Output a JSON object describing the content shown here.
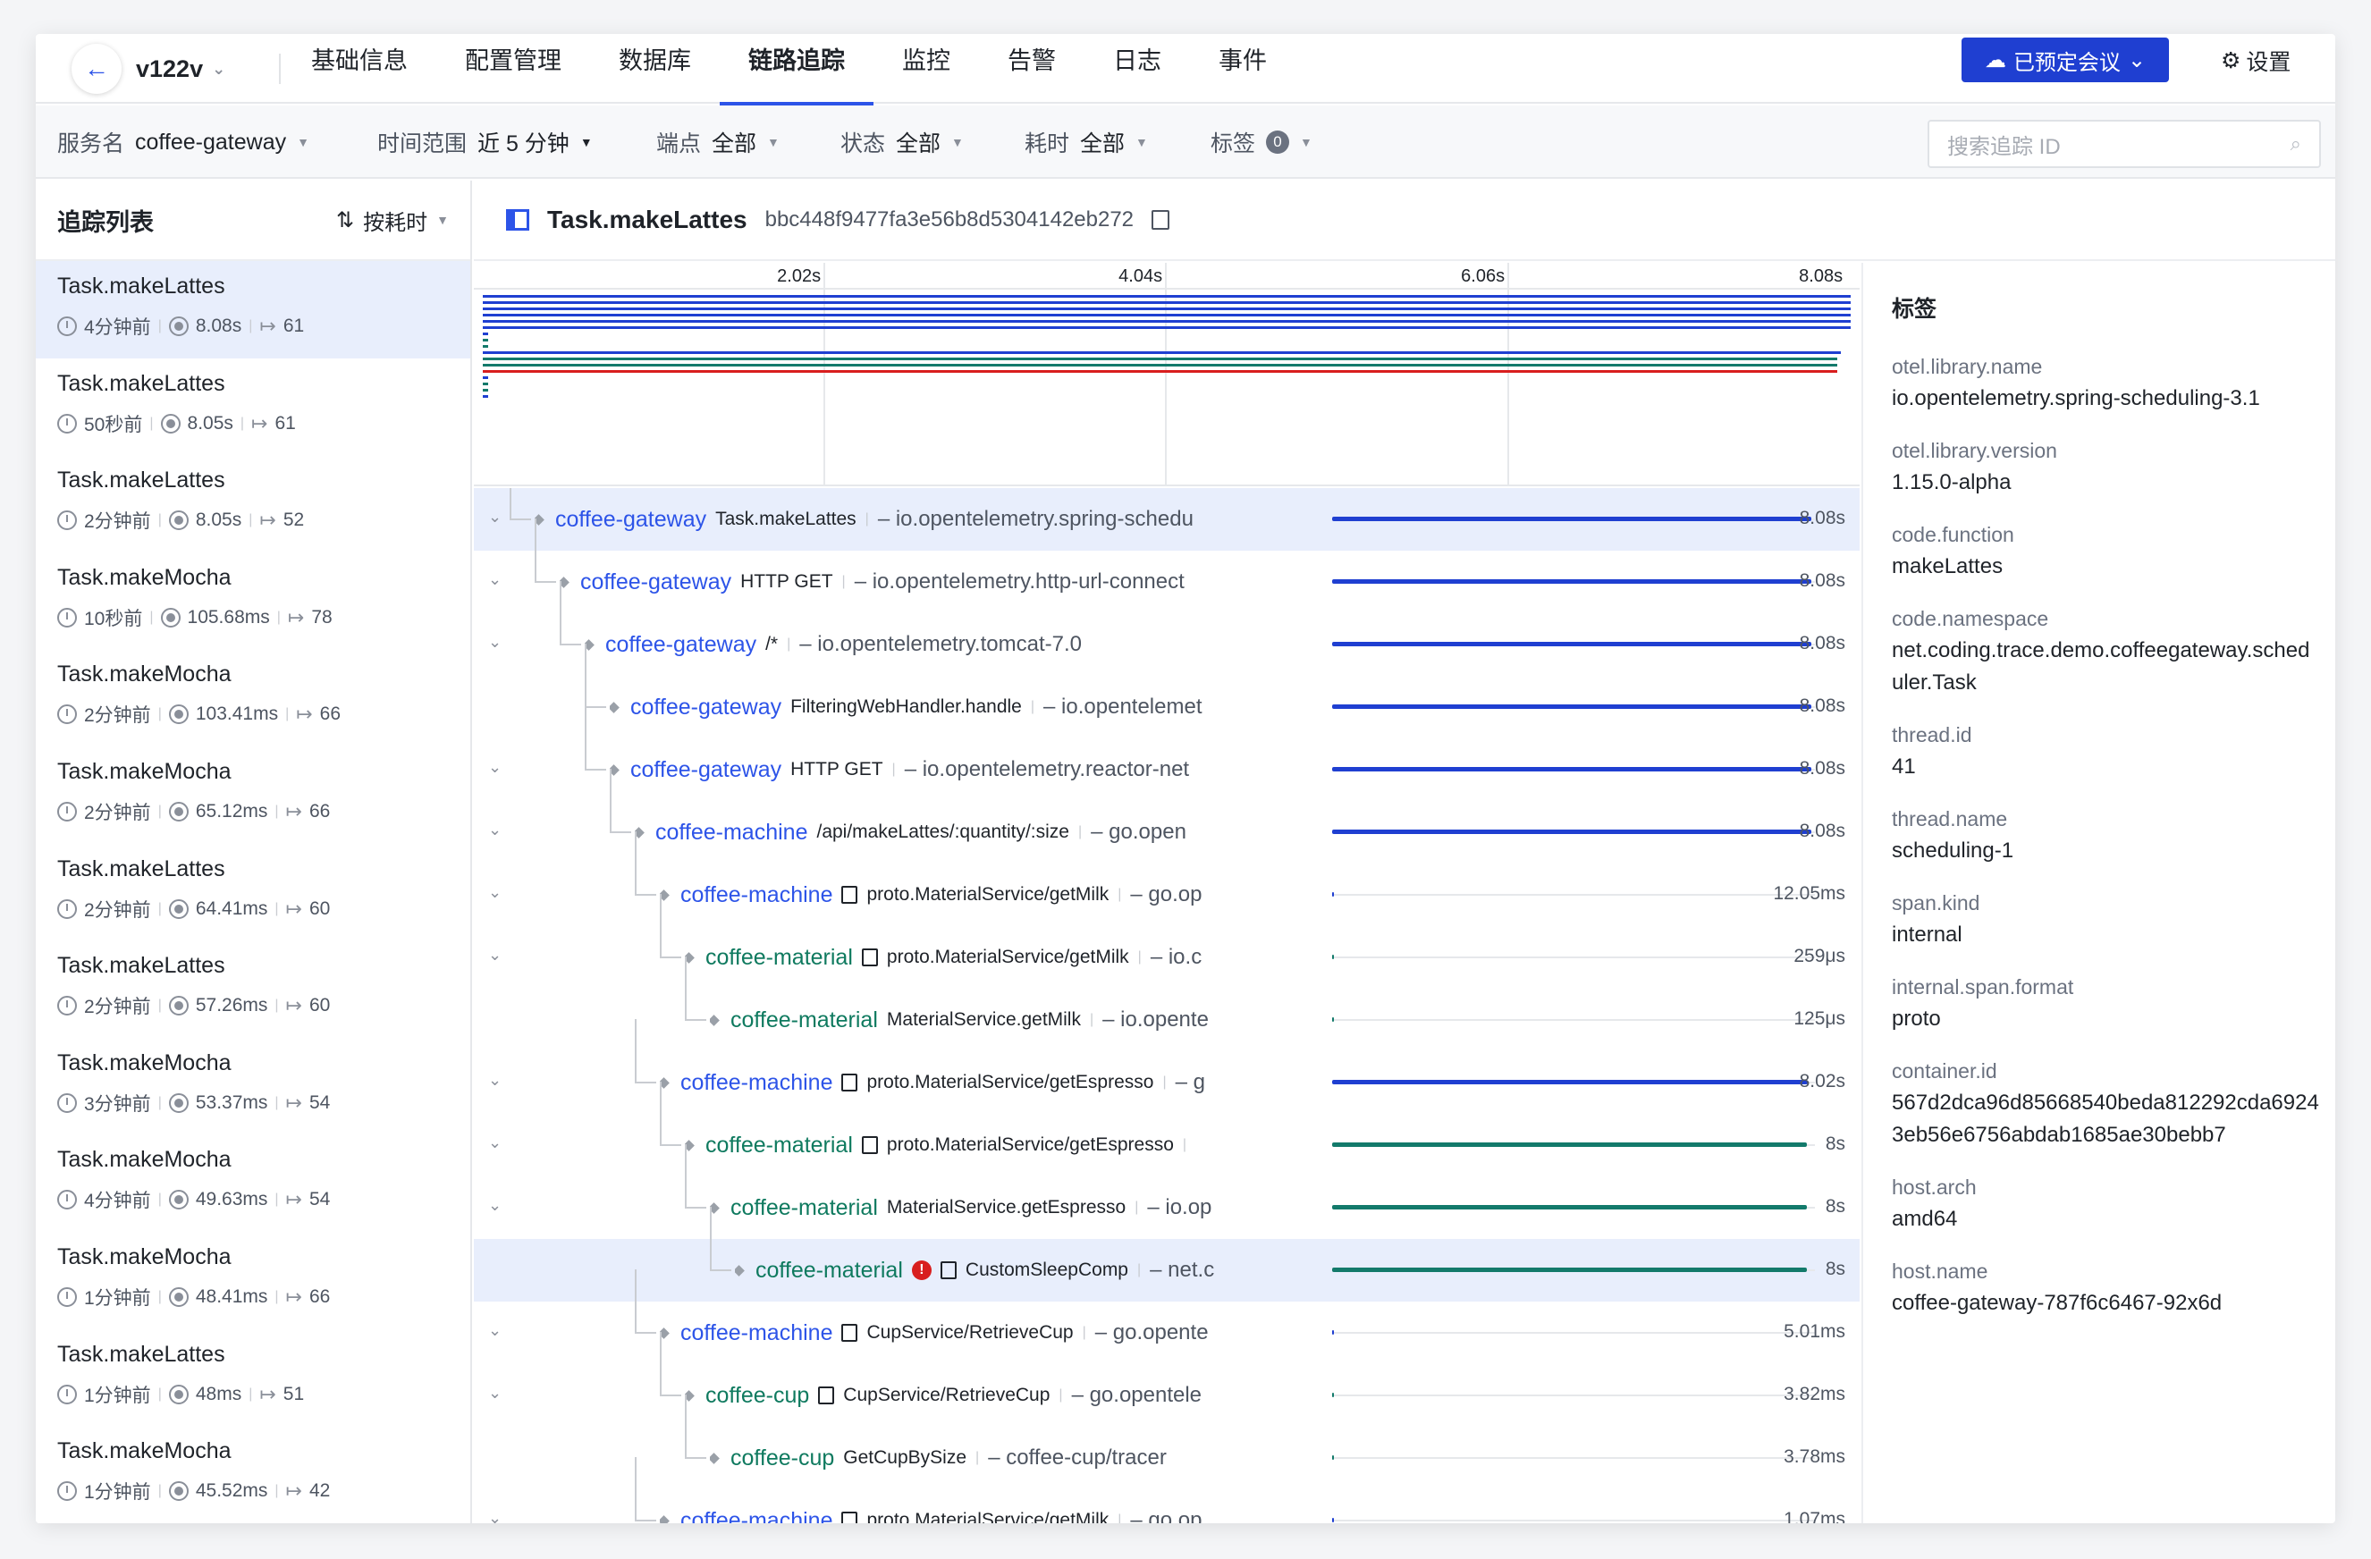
{
  "nav": {
    "project": "v122v",
    "tabs": [
      "基础信息",
      "配置管理",
      "数据库",
      "链路追踪",
      "监控",
      "告警",
      "日志",
      "事件"
    ],
    "active_tab": "链路追踪",
    "meeting_button": "已预定会议",
    "settings": "设置"
  },
  "filters": {
    "service_label": "服务名",
    "service_value": "coffee-gateway",
    "time_label": "时间范围",
    "time_value": "近 5 分钟",
    "endpoint_label": "端点",
    "endpoint_value": "全部",
    "status_label": "状态",
    "status_value": "全部",
    "duration_label": "耗时",
    "duration_value": "全部",
    "tags_label": "标签",
    "tags_count": "0",
    "search_placeholder": "搜索追踪 ID"
  },
  "trace_list": {
    "title": "追踪列表",
    "sort": "按耗时",
    "items": [
      {
        "name": "Task.makeLattes",
        "ago": "4分钟前",
        "duration": "8.08s",
        "spans": "61"
      },
      {
        "name": "Task.makeLattes",
        "ago": "50秒前",
        "duration": "8.05s",
        "spans": "61"
      },
      {
        "name": "Task.makeLattes",
        "ago": "2分钟前",
        "duration": "8.05s",
        "spans": "52"
      },
      {
        "name": "Task.makeMocha",
        "ago": "10秒前",
        "duration": "105.68ms",
        "spans": "78"
      },
      {
        "name": "Task.makeMocha",
        "ago": "2分钟前",
        "duration": "103.41ms",
        "spans": "66"
      },
      {
        "name": "Task.makeMocha",
        "ago": "2分钟前",
        "duration": "65.12ms",
        "spans": "66"
      },
      {
        "name": "Task.makeLattes",
        "ago": "2分钟前",
        "duration": "64.41ms",
        "spans": "60"
      },
      {
        "name": "Task.makeLattes",
        "ago": "2分钟前",
        "duration": "57.26ms",
        "spans": "60"
      },
      {
        "name": "Task.makeMocha",
        "ago": "3分钟前",
        "duration": "53.37ms",
        "spans": "54"
      },
      {
        "name": "Task.makeMocha",
        "ago": "4分钟前",
        "duration": "49.63ms",
        "spans": "54"
      },
      {
        "name": "Task.makeMocha",
        "ago": "1分钟前",
        "duration": "48.41ms",
        "spans": "66"
      },
      {
        "name": "Task.makeLattes",
        "ago": "1分钟前",
        "duration": "48ms",
        "spans": "51"
      },
      {
        "name": "Task.makeMocha",
        "ago": "1分钟前",
        "duration": "45.52ms",
        "spans": "42"
      }
    ]
  },
  "trace": {
    "name": "Task.makeLattes",
    "id": "bbc448f9477fa3e56b8d5304142eb272",
    "ticks": [
      "2.02s",
      "4.04s",
      "6.06s",
      "8.08s"
    ],
    "spans": [
      {
        "service": "coffee-gateway",
        "op": "Task.makeLattes",
        "lib": "– io.opentelemetry.spring-schedu",
        "dur": "8.08s",
        "depth": 0,
        "fraction": 1.0,
        "color": "#1f3fd1",
        "svc_color": "#2d54e8",
        "note": false,
        "error": false,
        "highlight": true,
        "chevron": true
      },
      {
        "service": "coffee-gateway",
        "op": "HTTP GET",
        "lib": "– io.opentelemetry.http-url-connect",
        "dur": "8.08s",
        "depth": 1,
        "fraction": 1.0,
        "color": "#1f3fd1",
        "svc_color": "#2d54e8",
        "note": false,
        "error": false,
        "highlight": false,
        "chevron": true
      },
      {
        "service": "coffee-gateway",
        "op": "/*",
        "lib": "– io.opentelemetry.tomcat-7.0",
        "dur": "8.08s",
        "depth": 2,
        "fraction": 1.0,
        "color": "#1f3fd1",
        "svc_color": "#2d54e8",
        "note": false,
        "error": false,
        "highlight": false,
        "chevron": true
      },
      {
        "service": "coffee-gateway",
        "op": "FilteringWebHandler.handle",
        "lib": "– io.opentelemet",
        "dur": "8.08s",
        "depth": 3,
        "fraction": 1.0,
        "color": "#1f3fd1",
        "svc_color": "#2d54e8",
        "note": false,
        "error": false,
        "highlight": false,
        "chevron": false
      },
      {
        "service": "coffee-gateway",
        "op": "HTTP GET",
        "lib": "– io.opentelemetry.reactor-net",
        "dur": "8.08s",
        "depth": 3,
        "fraction": 1.0,
        "color": "#1f3fd1",
        "svc_color": "#2d54e8",
        "note": false,
        "error": false,
        "highlight": false,
        "chevron": true
      },
      {
        "service": "coffee-machine",
        "op": "/api/makeLattes/:quantity/:size",
        "lib": "– go.open",
        "dur": "8.08s",
        "depth": 4,
        "fraction": 1.0,
        "color": "#1f3fd1",
        "svc_color": "#2d54e8",
        "note": false,
        "error": false,
        "highlight": false,
        "chevron": true
      },
      {
        "service": "coffee-machine",
        "op": "proto.MaterialService/getMilk",
        "lib": "– go.op",
        "dur": "12.05ms",
        "depth": 5,
        "fraction": 0.0015,
        "color": "#1f3fd1",
        "svc_color": "#2d54e8",
        "note": true,
        "error": false,
        "highlight": false,
        "chevron": true
      },
      {
        "service": "coffee-material",
        "op": "proto.MaterialService/getMilk",
        "lib": "– io.c",
        "dur": "259μs",
        "depth": 6,
        "fraction": 0.0001,
        "color": "#137a6b",
        "svc_color": "#0f7a5f",
        "note": true,
        "error": false,
        "highlight": false,
        "chevron": true
      },
      {
        "service": "coffee-material",
        "op": "MaterialService.getMilk",
        "lib": "– io.opente",
        "dur": "125μs",
        "depth": 7,
        "fraction": 0.0001,
        "color": "#137a6b",
        "svc_color": "#0f7a5f",
        "note": false,
        "error": false,
        "highlight": false,
        "chevron": false
      },
      {
        "service": "coffee-machine",
        "op": "proto.MaterialService/getEspresso",
        "lib": "– g",
        "dur": "8.02s",
        "depth": 5,
        "fraction": 0.993,
        "color": "#1f3fd1",
        "svc_color": "#2d54e8",
        "note": true,
        "error": false,
        "highlight": false,
        "chevron": true
      },
      {
        "service": "coffee-material",
        "op": "proto.MaterialService/getEspresso",
        "lib": "",
        "dur": "8s",
        "depth": 6,
        "fraction": 0.99,
        "color": "#137a6b",
        "svc_color": "#0f7a5f",
        "note": true,
        "error": false,
        "highlight": false,
        "chevron": true
      },
      {
        "service": "coffee-material",
        "op": "MaterialService.getEspresso",
        "lib": "– io.op",
        "dur": "8s",
        "depth": 7,
        "fraction": 0.99,
        "color": "#137a6b",
        "svc_color": "#0f7a5f",
        "note": false,
        "error": false,
        "highlight": false,
        "chevron": true
      },
      {
        "service": "coffee-material",
        "op": "CustomSleepComp",
        "lib": "– net.c",
        "dur": "8s",
        "depth": 8,
        "fraction": 0.99,
        "color": "#137a6b",
        "svc_color": "#0f7a5f",
        "note": true,
        "error": true,
        "highlight": true,
        "chevron": false
      },
      {
        "service": "coffee-machine",
        "op": "CupService/RetrieveCup",
        "lib": "– go.opente",
        "dur": "5.01ms",
        "depth": 5,
        "fraction": 0.0006,
        "color": "#1f3fd1",
        "svc_color": "#2d54e8",
        "note": true,
        "error": false,
        "highlight": false,
        "chevron": true
      },
      {
        "service": "coffee-cup",
        "op": "CupService/RetrieveCup",
        "lib": "– go.opentele",
        "dur": "3.82ms",
        "depth": 6,
        "fraction": 0.0005,
        "color": "#137a6b",
        "svc_color": "#0f7a5f",
        "note": true,
        "error": false,
        "highlight": false,
        "chevron": true
      },
      {
        "service": "coffee-cup",
        "op": "GetCupBySize",
        "lib": "– coffee-cup/tracer",
        "dur": "3.78ms",
        "depth": 7,
        "fraction": 0.0005,
        "color": "#137a6b",
        "svc_color": "#0f7a5f",
        "note": false,
        "error": false,
        "highlight": false,
        "chevron": false
      },
      {
        "service": "coffee-machine",
        "op": "proto.MaterialService/getMilk",
        "lib": "– go.op",
        "dur": "1.07ms",
        "depth": 5,
        "fraction": 0.0001,
        "color": "#1f3fd1",
        "svc_color": "#2d54e8",
        "note": true,
        "error": false,
        "highlight": false,
        "chevron": true
      }
    ]
  },
  "tags": {
    "title": "标签",
    "items": [
      {
        "key": "otel.library.name",
        "value": "io.opentelemetry.spring-scheduling-3.1"
      },
      {
        "key": "otel.library.version",
        "value": "1.15.0-alpha"
      },
      {
        "key": "code.function",
        "value": "makeLattes"
      },
      {
        "key": "code.namespace",
        "value": "net.coding.trace.demo.coffeegateway.scheduler.Task"
      },
      {
        "key": "thread.id",
        "value": "41"
      },
      {
        "key": "thread.name",
        "value": "scheduling-1"
      },
      {
        "key": "span.kind",
        "value": "internal"
      },
      {
        "key": "internal.span.format",
        "value": "proto"
      },
      {
        "key": "container.id",
        "value": "567d2dca96d85668540beda812292cda69243eb56e6756abdab1685ae30bebb7"
      },
      {
        "key": "host.arch",
        "value": "amd64"
      },
      {
        "key": "host.name",
        "value": "coffee-gateway-787f6c6467-92x6d"
      }
    ]
  }
}
